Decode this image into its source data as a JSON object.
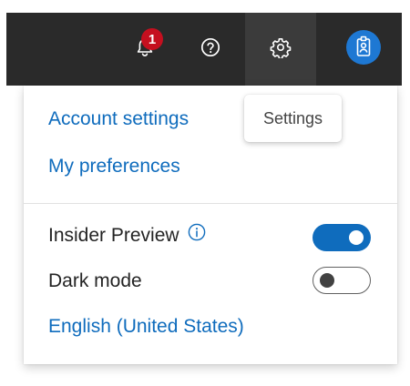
{
  "topbar": {
    "notification_count": "1",
    "icons": [
      "bell-icon",
      "help-icon",
      "gear-icon",
      "badge-icon"
    ]
  },
  "tooltip": {
    "text": "Settings"
  },
  "menu": {
    "account_settings": "Account settings",
    "my_preferences": "My preferences",
    "insider_preview": {
      "label": "Insider Preview",
      "enabled": true
    },
    "dark_mode": {
      "label": "Dark mode",
      "enabled": false
    },
    "language": "English (United States)"
  },
  "colors": {
    "accent": "#0f6cbd",
    "topbar": "#2a2a2a",
    "badge": "#c50f1f",
    "avatar": "#1e78d3"
  }
}
